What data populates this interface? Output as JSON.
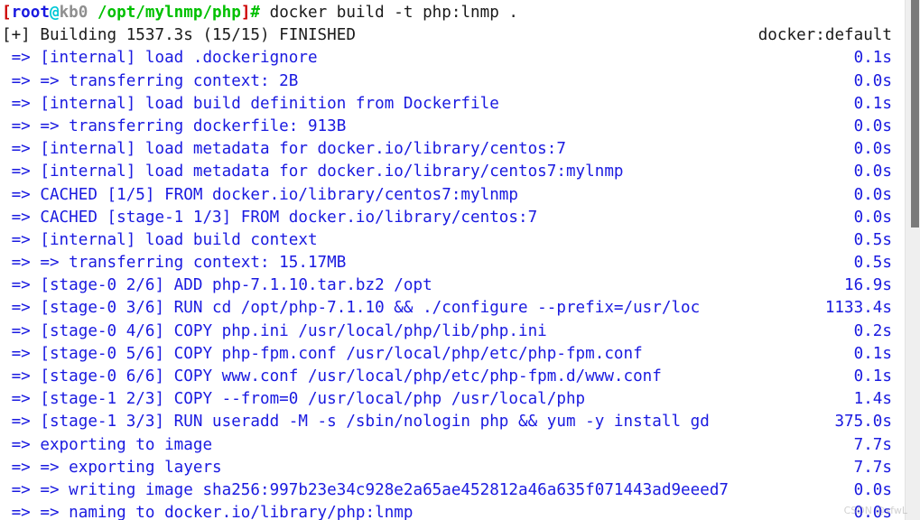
{
  "terminal": {
    "background": "#ffffff",
    "text_color": "#1a1ae0",
    "prompt": {
      "bracket_open": "[",
      "user": "root",
      "at": "@",
      "host": "kb0",
      "path": " /opt/mylnmp/php",
      "bracket_close": "]",
      "sigil": "#",
      "command": " docker build -t php:lnmp ."
    },
    "header": {
      "text": "[+] Building 1537.3s (15/15) FINISHED",
      "driver": "docker:default"
    },
    "watermark": "CSDN @sfwL",
    "scrollbar": {
      "name": "vertical-scrollbar"
    },
    "steps": [
      {
        "text": " => [internal] load .dockerignore",
        "duration": "0.1s"
      },
      {
        "text": " => => transferring context: 2B",
        "duration": "0.0s"
      },
      {
        "text": " => [internal] load build definition from Dockerfile",
        "duration": "0.1s"
      },
      {
        "text": " => => transferring dockerfile: 913B",
        "duration": "0.0s"
      },
      {
        "text": " => [internal] load metadata for docker.io/library/centos:7",
        "duration": "0.0s"
      },
      {
        "text": " => [internal] load metadata for docker.io/library/centos7:mylnmp",
        "duration": "0.0s"
      },
      {
        "text": " => CACHED [1/5] FROM docker.io/library/centos7:mylnmp",
        "duration": "0.0s"
      },
      {
        "text": " => CACHED [stage-1 1/3] FROM docker.io/library/centos:7",
        "duration": "0.0s"
      },
      {
        "text": " => [internal] load build context",
        "duration": "0.5s"
      },
      {
        "text": " => => transferring context: 15.17MB",
        "duration": "0.5s"
      },
      {
        "text": " => [stage-0 2/6] ADD php-7.1.10.tar.bz2 /opt",
        "duration": "16.9s"
      },
      {
        "text": " => [stage-0 3/6] RUN cd /opt/php-7.1.10 && ./configure --prefix=/usr/loc",
        "duration": "1133.4s"
      },
      {
        "text": " => [stage-0 4/6] COPY php.ini /usr/local/php/lib/php.ini",
        "duration": "0.2s"
      },
      {
        "text": " => [stage-0 5/6] COPY php-fpm.conf /usr/local/php/etc/php-fpm.conf",
        "duration": "0.1s"
      },
      {
        "text": " => [stage-0 6/6] COPY www.conf /usr/local/php/etc/php-fpm.d/www.conf",
        "duration": "0.1s"
      },
      {
        "text": " => [stage-1 2/3] COPY --from=0 /usr/local/php /usr/local/php",
        "duration": "1.4s"
      },
      {
        "text": " => [stage-1 3/3] RUN useradd -M -s /sbin/nologin php && yum -y install gd",
        "duration": "375.0s"
      },
      {
        "text": " => exporting to image",
        "duration": "7.7s"
      },
      {
        "text": " => => exporting layers",
        "duration": "7.7s"
      },
      {
        "text": " => => writing image sha256:997b23e34c928e2a65ae452812a46a635f071443ad9eeed7",
        "duration": "0.0s"
      },
      {
        "text": " => => naming to docker.io/library/php:lnmp",
        "duration": "0.0s"
      }
    ]
  }
}
